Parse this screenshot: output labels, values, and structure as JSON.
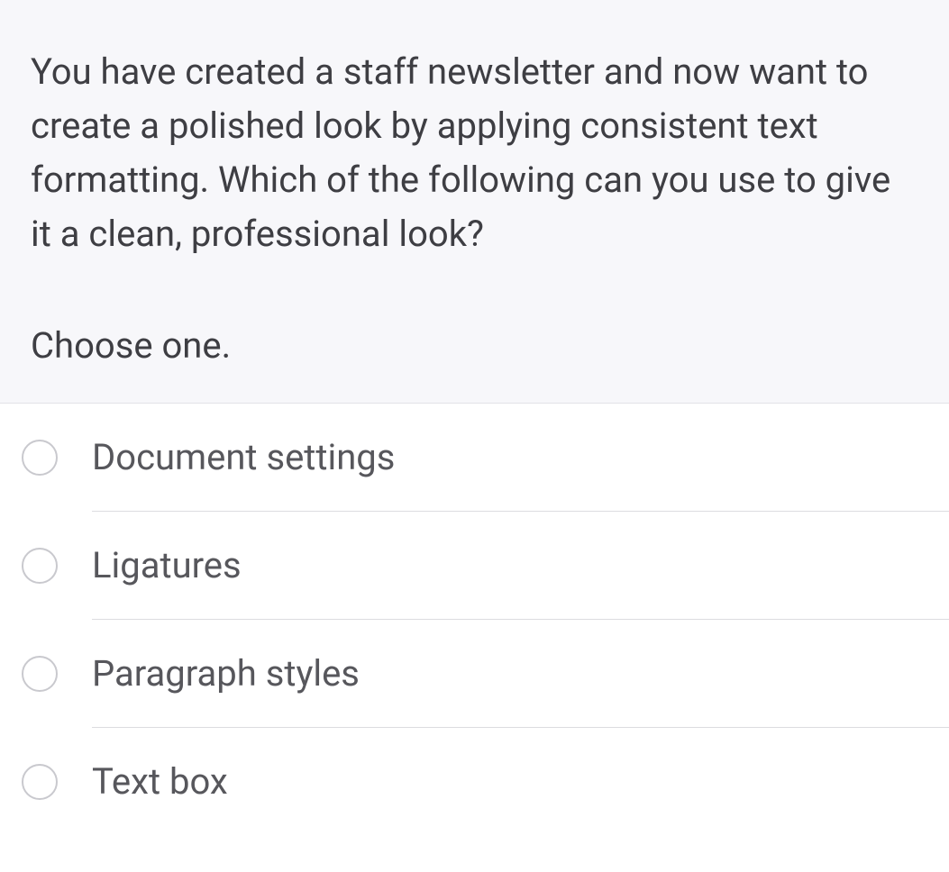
{
  "question": {
    "text": "You have created a staff newsletter and now want to create a polished look by applying consistent text formatting. Which of the following can you use to give it a clean, professional look?",
    "instruction": "Choose one."
  },
  "options": [
    {
      "label": "Document settings"
    },
    {
      "label": "Ligatures"
    },
    {
      "label": "Paragraph styles"
    },
    {
      "label": "Text box"
    }
  ]
}
